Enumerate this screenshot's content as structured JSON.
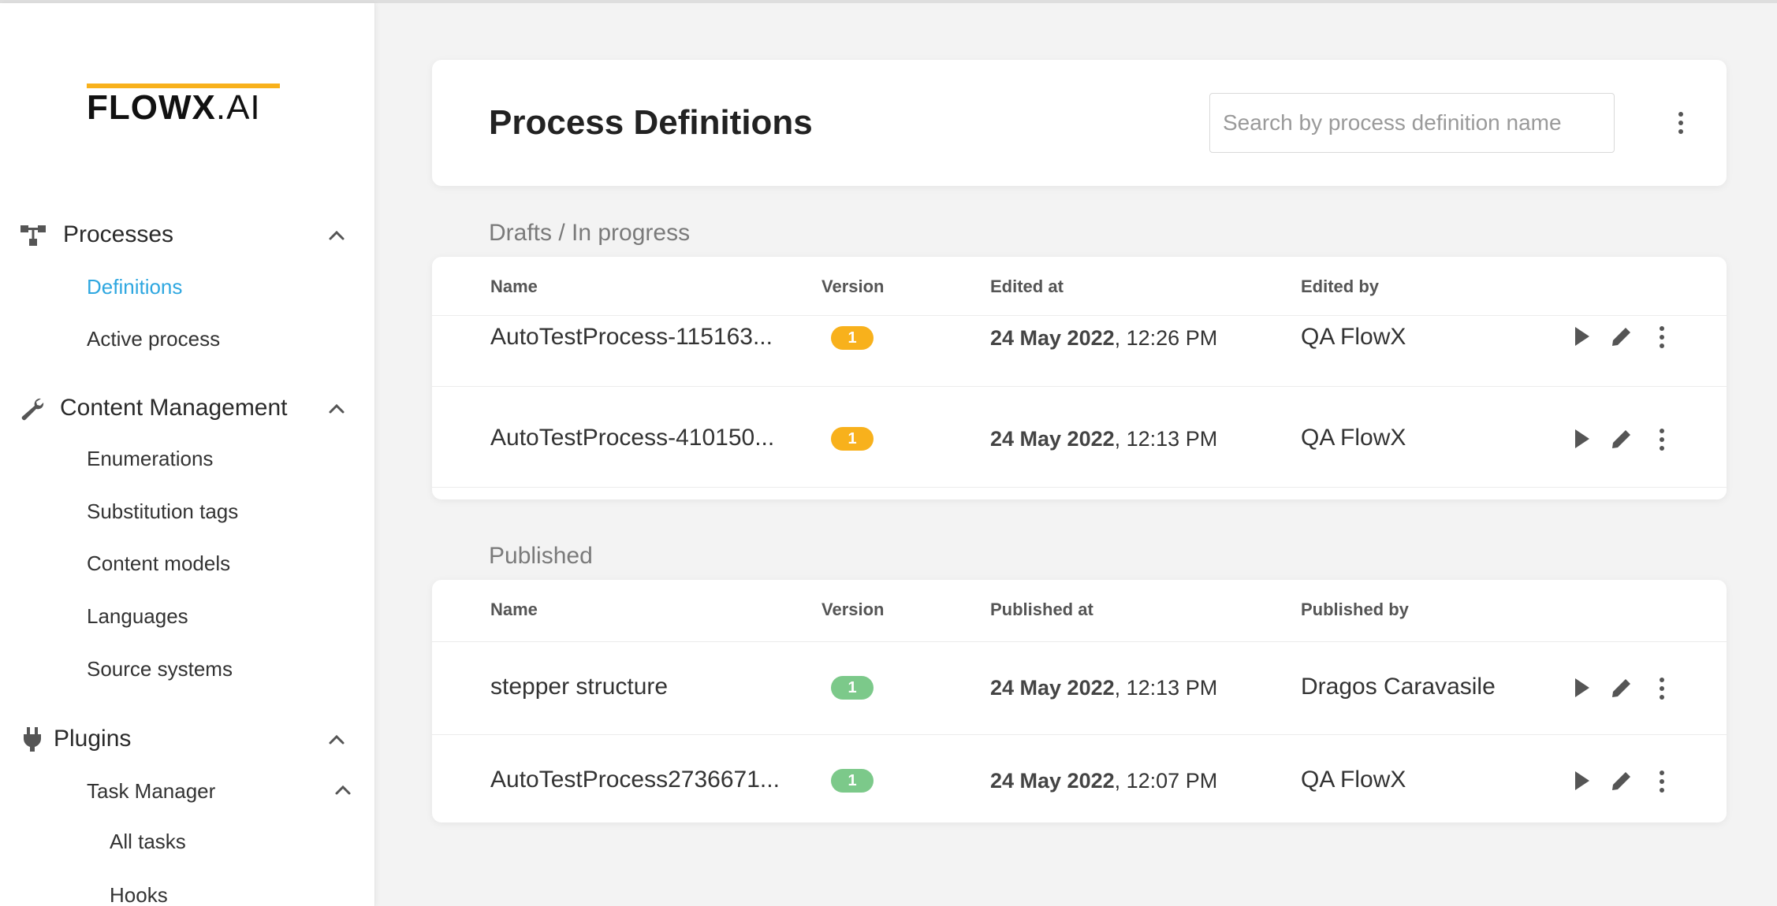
{
  "brand": {
    "logo_bold": "FLOWX",
    "logo_light": ".AI",
    "accent_color": "#f8b11c",
    "link_color": "#2ea7e0"
  },
  "sidebar": {
    "processes": {
      "label": "Processes",
      "icon": "flow-icon",
      "items": [
        {
          "label": "Definitions",
          "active": true
        },
        {
          "label": "Active process",
          "active": false
        }
      ]
    },
    "content_management": {
      "label": "Content Management",
      "icon": "wrench-icon",
      "items": [
        {
          "label": "Enumerations"
        },
        {
          "label": "Substitution tags"
        },
        {
          "label": "Content models"
        },
        {
          "label": "Languages"
        },
        {
          "label": "Source systems"
        }
      ]
    },
    "plugins": {
      "label": "Plugins",
      "icon": "plug-icon",
      "task_manager": {
        "label": "Task Manager",
        "items": [
          {
            "label": "All tasks"
          },
          {
            "label": "Hooks"
          }
        ]
      }
    }
  },
  "header": {
    "title": "Process Definitions",
    "search_placeholder": "Search by process definition name"
  },
  "drafts": {
    "title": "Drafts / In progress",
    "columns": {
      "name": "Name",
      "version": "Version",
      "date": "Edited at",
      "user": "Edited by"
    },
    "badge_color": "#f8b11c",
    "rows": [
      {
        "name": "AutoTestProcess-115163...",
        "version": "1",
        "date": "24 May 2022",
        "time": ", 12:26 PM",
        "user": "QA FlowX"
      },
      {
        "name": "AutoTestProcess-410150...",
        "version": "1",
        "date": "24 May 2022",
        "time": ", 12:13 PM",
        "user": "QA FlowX"
      }
    ]
  },
  "published": {
    "title": "Published",
    "columns": {
      "name": "Name",
      "version": "Version",
      "date": "Published at",
      "user": "Published by"
    },
    "badge_color": "#7cc98a",
    "rows": [
      {
        "name": "stepper structure",
        "version": "1",
        "date": "24 May 2022",
        "time": ", 12:13 PM",
        "user": "Dragos Caravasile"
      },
      {
        "name": "AutoTestProcess2736671...",
        "version": "1",
        "date": "24 May 2022",
        "time": ", 12:07 PM",
        "user": "QA FlowX"
      }
    ]
  }
}
